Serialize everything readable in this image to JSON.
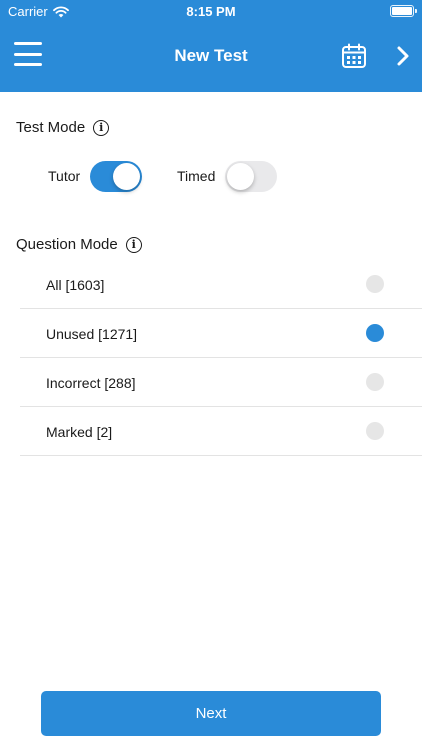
{
  "status_bar": {
    "carrier": "Carrier",
    "time": "8:15 PM"
  },
  "header": {
    "title": "New Test",
    "icons": [
      "menu-icon",
      "calendar-icon",
      "chevron-right-icon"
    ]
  },
  "test_mode": {
    "label": "Test Mode",
    "toggles": [
      {
        "label": "Tutor",
        "on": true
      },
      {
        "label": "Timed",
        "on": false
      }
    ]
  },
  "question_mode": {
    "label": "Question Mode",
    "options": [
      {
        "label": "All [1603]",
        "selected": false
      },
      {
        "label": "Unused [1271]",
        "selected": true
      },
      {
        "label": "Incorrect [288]",
        "selected": false
      },
      {
        "label": "Marked [2]",
        "selected": false
      }
    ]
  },
  "footer": {
    "next_label": "Next"
  },
  "colors": {
    "accent": "#2a8bd8",
    "radio_off": "#e6e6e6",
    "switch_off": "#e9e9eb"
  }
}
